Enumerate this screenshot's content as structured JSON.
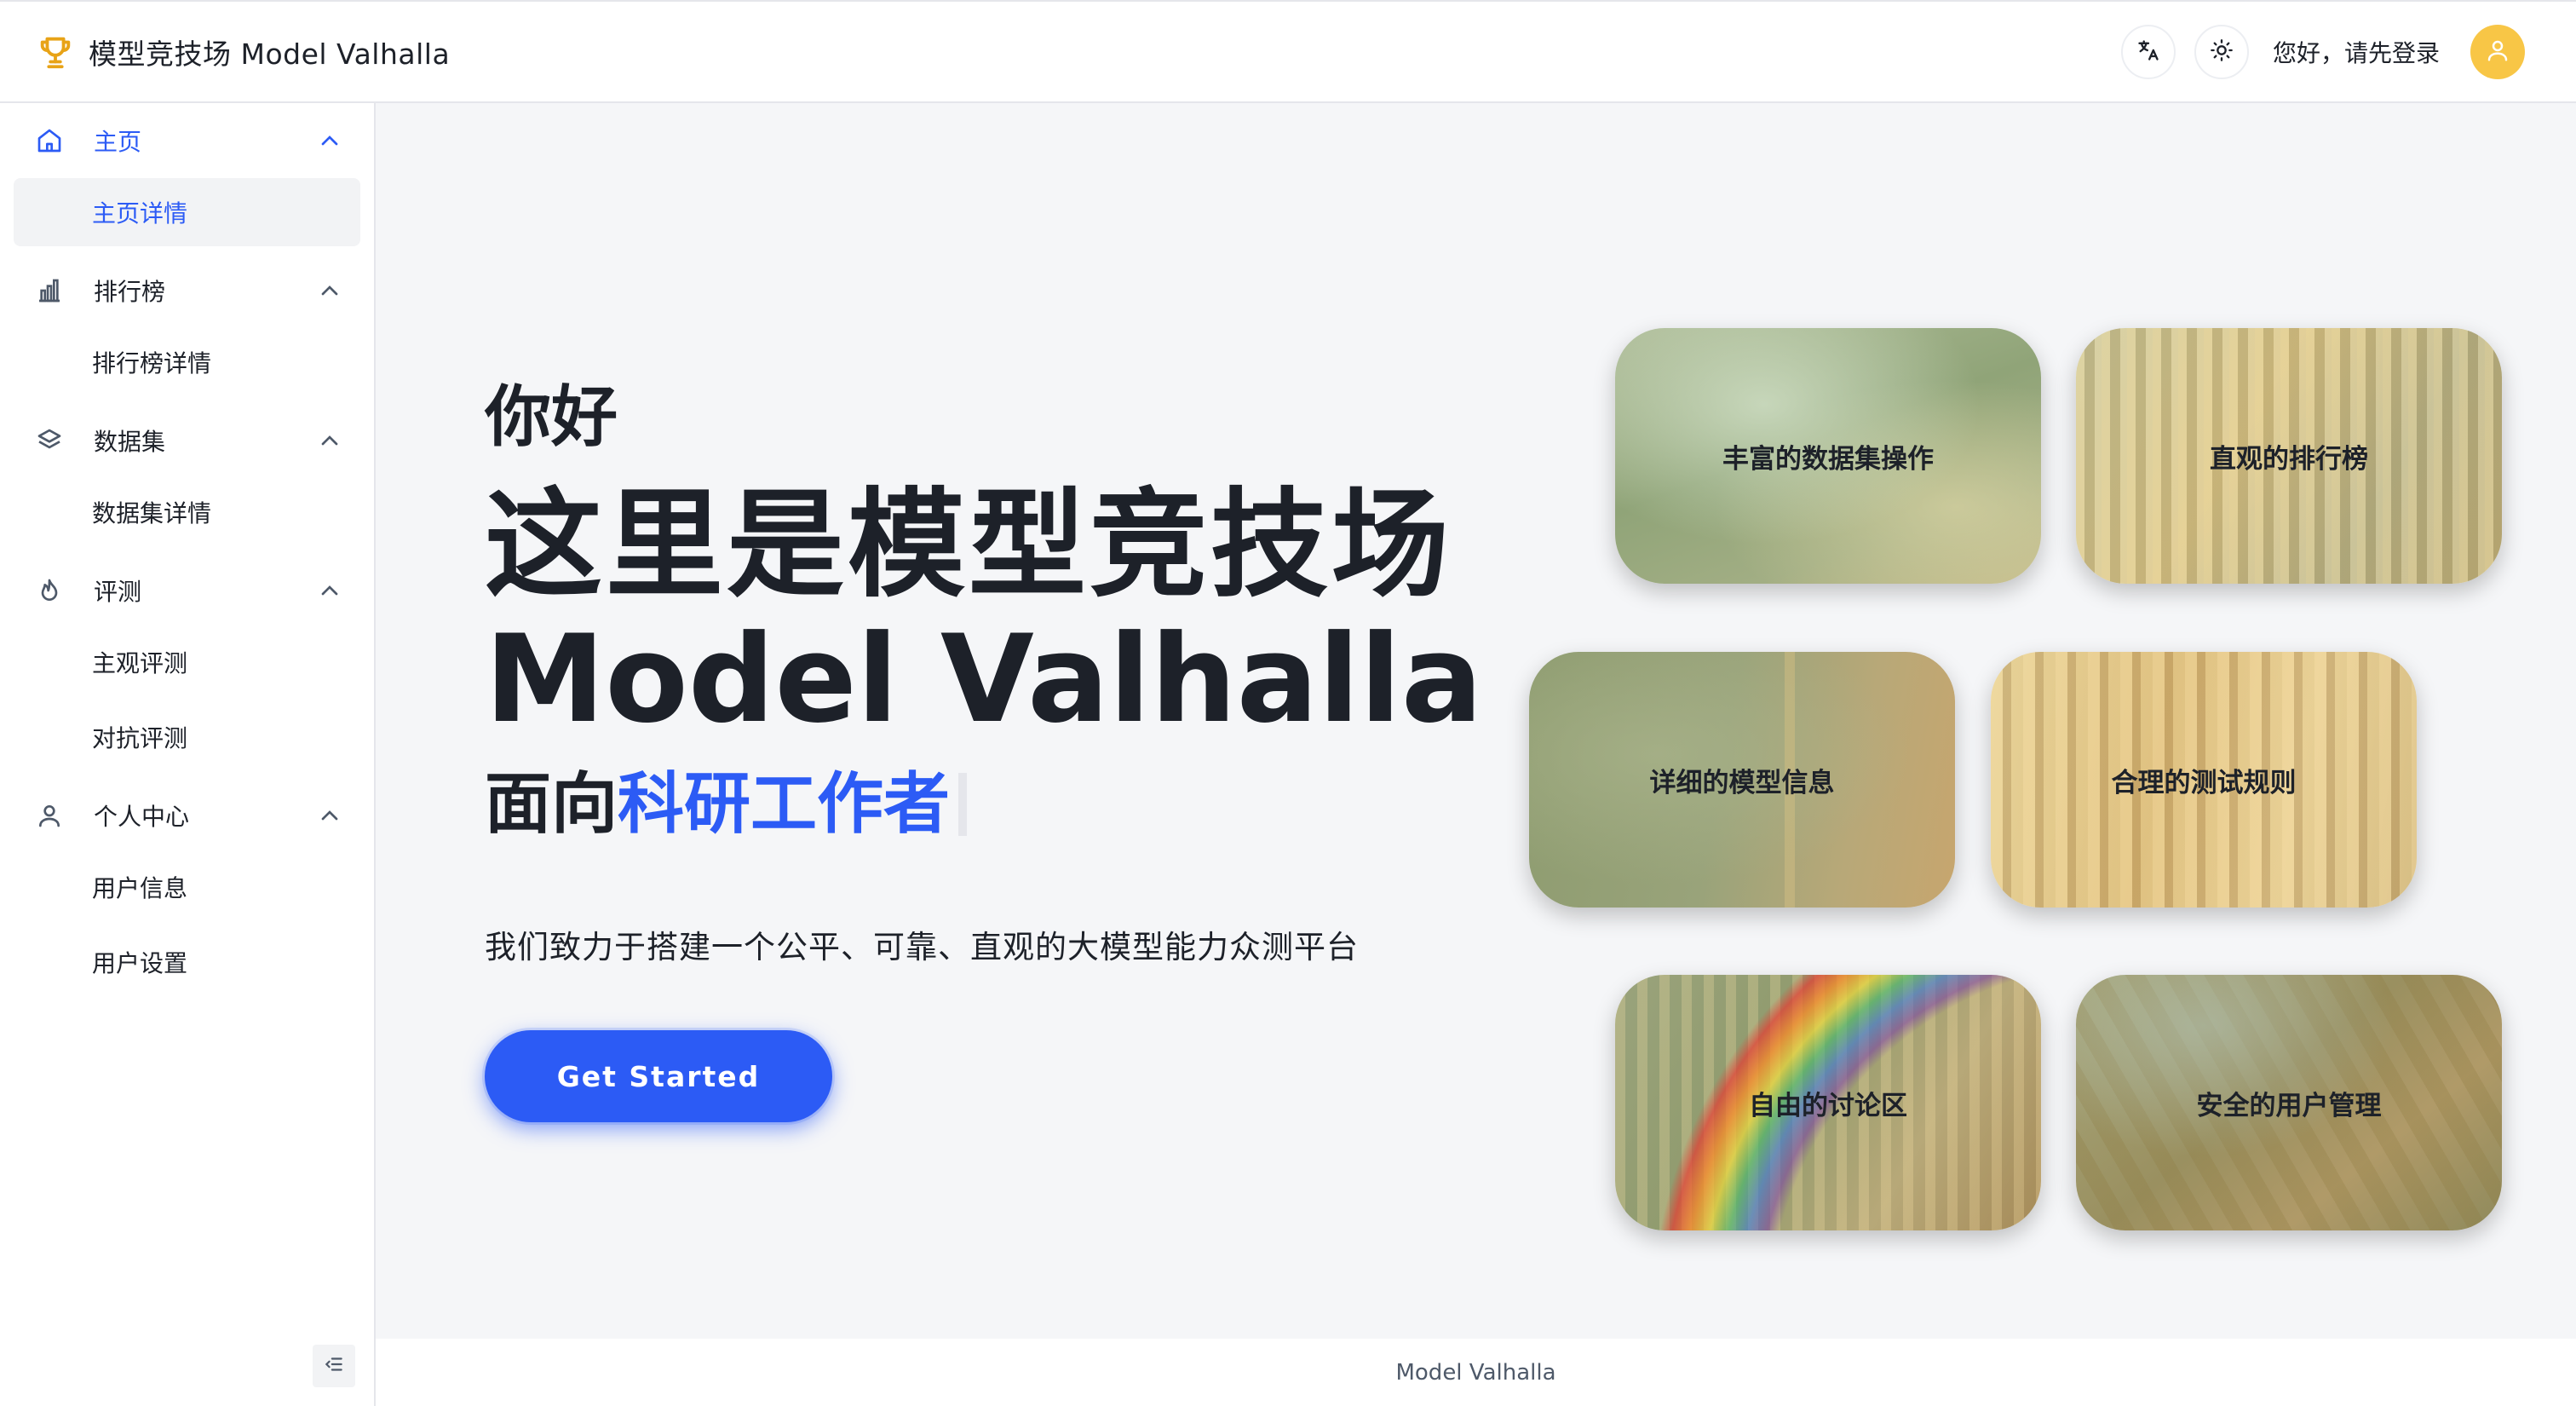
{
  "app": {
    "title": "模型竞技场 Model Valhalla",
    "greeting": "您好，请先登录"
  },
  "sidebar": {
    "groups": [
      {
        "label": "主页",
        "icon": "home-icon",
        "sub": [
          "主页详情"
        ]
      },
      {
        "label": "排行榜",
        "icon": "bar-chart-icon",
        "sub": [
          "排行榜详情"
        ]
      },
      {
        "label": "数据集",
        "icon": "layers-icon",
        "sub": [
          "数据集详情"
        ]
      },
      {
        "label": "评测",
        "icon": "fire-icon",
        "sub": [
          "主观评测",
          "对抗评测"
        ]
      },
      {
        "label": "个人中心",
        "icon": "user-icon",
        "sub": [
          "用户信息",
          "用户设置"
        ]
      }
    ],
    "selected": "主页详情"
  },
  "hero": {
    "hello": "你好",
    "headline_cn": "这里是模型竞技场",
    "headline_en": "Model Valhalla",
    "sub_prefix": "面向",
    "sub_highlight": "科研工作者",
    "tagline": "我们致力于搭建一个公平、可靠、直观的大模型能力众测平台",
    "cta": "Get Started"
  },
  "features": [
    "丰富的数据集操作",
    "直观的排行榜",
    "详细的模型信息",
    "合理的测试规则",
    "自由的讨论区",
    "安全的用户管理"
  ],
  "footer": {
    "text": "Model Valhalla"
  },
  "colors": {
    "accent": "#2c5bf5",
    "avatar": "#f8c646",
    "logo": "#e8a317"
  }
}
